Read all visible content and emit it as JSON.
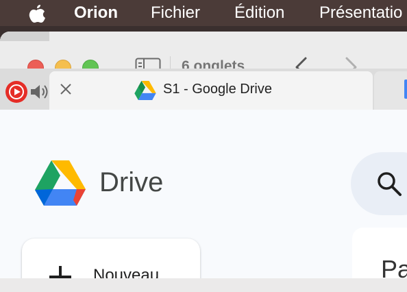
{
  "menubar": {
    "apple_icon": "apple-logo",
    "items": [
      "Orion",
      "Fichier",
      "Édition",
      "Présentatio"
    ]
  },
  "toolbar": {
    "tab_count_label": "6 onglets"
  },
  "tabs": {
    "active_title": "S1 - Google Drive"
  },
  "page": {
    "brand_name": "Drive",
    "new_button_label": "Nouveau",
    "panel_text": "Pa"
  },
  "colors": {
    "close": "#ec5f57",
    "minimize": "#f5bf4f",
    "zoom": "#61c454",
    "drive_green": "#1ea362",
    "drive_yellow": "#ffba00",
    "drive_blue": "#4285f4"
  }
}
